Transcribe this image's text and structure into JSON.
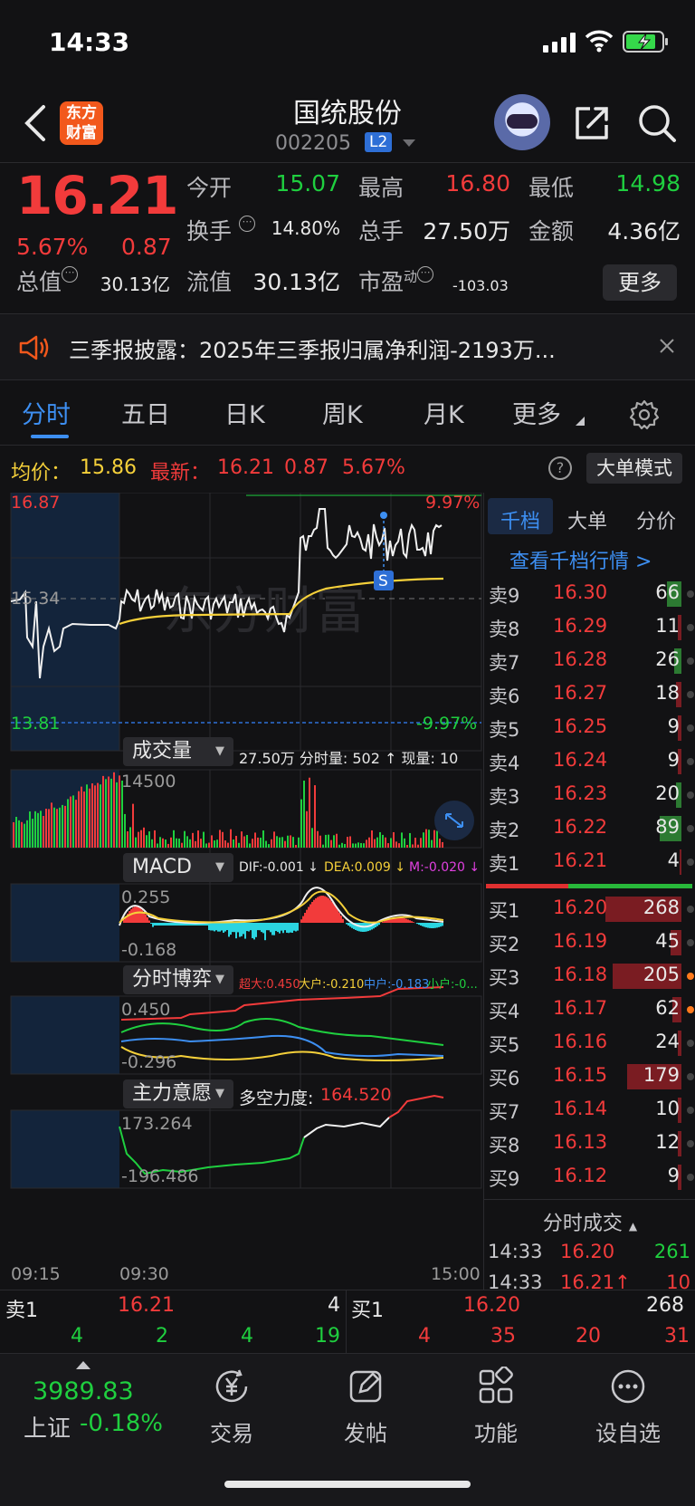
{
  "status_bar": {
    "time": "14:33"
  },
  "nav": {
    "logo_line1": "东方",
    "logo_line2": "财富",
    "title": "国统股份",
    "code": "002205",
    "level_badge": "L2"
  },
  "quote": {
    "price": "16.21",
    "change_pct": "5.67%",
    "change": "0.87",
    "fields": {
      "open_label": "今开",
      "open": "15.07",
      "high_label": "最高",
      "high": "16.80",
      "low_label": "最低",
      "low": "14.98",
      "turnover_label": "换手",
      "turnover": "14.80%",
      "volume_label": "总手",
      "volume": "27.50万",
      "amount_label": "金额",
      "amount": "4.36亿",
      "mcap_label": "总值",
      "mcap": "30.13亿",
      "float_label": "流值",
      "float": "30.13亿",
      "pe_label": "市盈",
      "pe_sup": "动",
      "pe": "-103.03"
    },
    "more_label": "更多"
  },
  "notice": {
    "text": "三季报披露：2025年三季报归属净利润-2193万..."
  },
  "tabs": [
    {
      "label": "分时",
      "active": true
    },
    {
      "label": "五日"
    },
    {
      "label": "日K"
    },
    {
      "label": "周K"
    },
    {
      "label": "月K"
    },
    {
      "label": "更多"
    }
  ],
  "avg_row": {
    "avg_label": "均价：",
    "avg": "15.86",
    "latest_label": "最新：",
    "latest": "16.21",
    "chg": "0.87",
    "pct": "5.67%",
    "big_order_mode": "大单模式"
  },
  "intraday": {
    "top_price": "16.87",
    "mid_price": "15.34",
    "bottom_price": "13.81",
    "top_pct": "9.97%",
    "bottom_pct": "-9.97%",
    "marker": "S"
  },
  "volume_panel": {
    "title": "成交量",
    "summary": "27.50万 分时量: 502 ↑ 现量: 10",
    "axis_max": "14500"
  },
  "macd_panel": {
    "title": "MACD",
    "dif": "DIF:-0.001 ↓",
    "dea": "DEA:0.009 ↓",
    "m": "M:-0.020 ↓",
    "axis_max": "0.255",
    "axis_min": "-0.168"
  },
  "game_panel": {
    "title": "分时博弈",
    "super": "超大:0.450",
    "big": "大户:-0.210",
    "mid": "中户:-0.183",
    "small": "小户:-0...",
    "axis_max": "0.450",
    "axis_min": "-0.296"
  },
  "will_panel": {
    "title": "主力意愿",
    "force_label": "多空力度:",
    "force": "164.520",
    "axis_max": "173.264",
    "axis_min": "-196.486"
  },
  "time_axis": {
    "t0": "09:15",
    "t1": "09:30",
    "t2": "15:00"
  },
  "colors": {
    "up": "#f23b3b",
    "down": "#1fcf3f",
    "avg_line": "#f5d03a",
    "accent": "#3d8ff2",
    "brand": "#f2581c"
  },
  "order_book": {
    "tabs": [
      "千档",
      "大单",
      "分价"
    ],
    "view_depth": "查看千档行情 >",
    "asks": [
      {
        "level": "卖9",
        "price": "16.30",
        "qty": "66",
        "bar": 0.08,
        "green": true
      },
      {
        "level": "卖8",
        "price": "16.29",
        "qty": "11",
        "bar": 0.02
      },
      {
        "level": "卖7",
        "price": "16.28",
        "qty": "26",
        "bar": 0.04,
        "green": true
      },
      {
        "level": "卖6",
        "price": "16.27",
        "qty": "18",
        "bar": 0.03
      },
      {
        "level": "卖5",
        "price": "16.25",
        "qty": "9",
        "bar": 0.02
      },
      {
        "level": "卖4",
        "price": "16.24",
        "qty": "9",
        "bar": 0.02
      },
      {
        "level": "卖3",
        "price": "16.23",
        "qty": "20",
        "bar": 0.03,
        "green": true
      },
      {
        "level": "卖2",
        "price": "16.22",
        "qty": "89",
        "bar": 0.12,
        "green": true
      },
      {
        "level": "卖1",
        "price": "16.21",
        "qty": "4",
        "bar": 0.01
      }
    ],
    "bids": [
      {
        "level": "买1",
        "price": "16.20",
        "qty": "268",
        "bar": 0.42
      },
      {
        "level": "买2",
        "price": "16.19",
        "qty": "45",
        "bar": 0.06
      },
      {
        "level": "买3",
        "price": "16.18",
        "qty": "205",
        "bar": 0.38,
        "orange": true
      },
      {
        "level": "买4",
        "price": "16.17",
        "qty": "62",
        "bar": 0.05,
        "orange": true
      },
      {
        "level": "买5",
        "price": "16.16",
        "qty": "24",
        "bar": 0.02
      },
      {
        "level": "买6",
        "price": "16.15",
        "qty": "179",
        "bar": 0.3
      },
      {
        "level": "买7",
        "price": "16.14",
        "qty": "10",
        "bar": 0.02
      },
      {
        "level": "买8",
        "price": "16.13",
        "qty": "12",
        "bar": 0.02
      },
      {
        "level": "买9",
        "price": "16.12",
        "qty": "9",
        "bar": 0.02
      }
    ],
    "trades_title": "分时成交",
    "trades": [
      {
        "time": "14:33",
        "price": "16.20",
        "qty": "261",
        "up": false
      },
      {
        "time": "14:33",
        "price": "16.21↑",
        "qty": "10",
        "up": true
      }
    ]
  },
  "strip": {
    "ask_label": "卖1",
    "ask_price": "16.21",
    "ask_qty": "4",
    "bid_label": "买1",
    "bid_price": "16.20",
    "bid_qty": "268",
    "left_nums": [
      "4",
      "2",
      "4",
      "19"
    ],
    "right_nums": [
      "4",
      "35",
      "20",
      "31"
    ]
  },
  "bottom_bar": {
    "index_value": "3989.83",
    "index_name": "上证",
    "index_pct": "-0.18%",
    "items": [
      "交易",
      "发帖",
      "功能",
      "设自选"
    ]
  }
}
